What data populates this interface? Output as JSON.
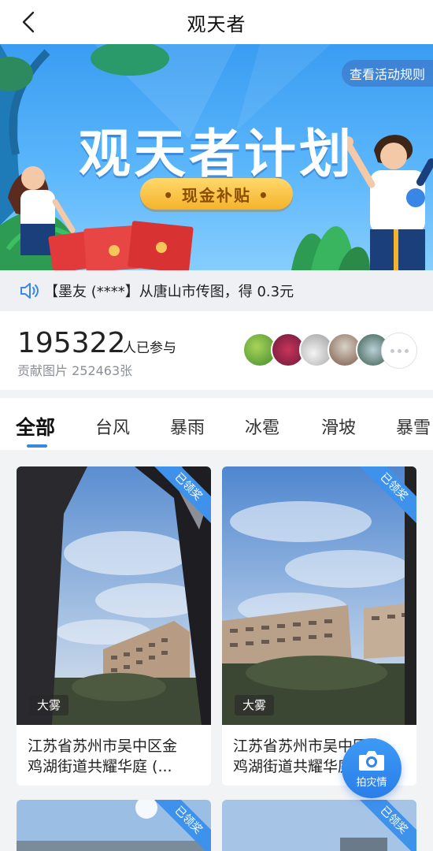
{
  "header": {
    "title": "观天者",
    "back_icon": "chevron-left-icon"
  },
  "banner": {
    "rules_label": "查看活动规则",
    "title": "观天者计划",
    "subsidy_label": "• 现金补贴 •"
  },
  "ticker": {
    "text": "【墨友 (****】从唐山市传图，得 0.3元",
    "icon": "speaker-icon"
  },
  "stats": {
    "count": "195322",
    "count_label": "人已参与",
    "contrib": "贡献图片 252463张"
  },
  "tabs": [
    "全部",
    "台风",
    "暴雨",
    "冰雹",
    "滑坡",
    "暴雪"
  ],
  "cards": [
    {
      "ribbon": "已领奖",
      "tag": "大雾",
      "text": "江苏省苏州市吴中区金\n鸡湖街道共耀华庭 (..."
    },
    {
      "ribbon": "已领奖",
      "tag": "大雾",
      "text": "江苏省苏州市吴中区金\n鸡湖街道共耀华庭 (..."
    },
    {
      "ribbon": "已领奖"
    },
    {
      "ribbon": "已领奖"
    }
  ],
  "fab": {
    "label": "拍灾情",
    "icon": "camera-icon"
  },
  "colors": {
    "accent": "#3a86e6",
    "banner_sky": "#4aaaf6",
    "pill": "#f5b32b"
  }
}
